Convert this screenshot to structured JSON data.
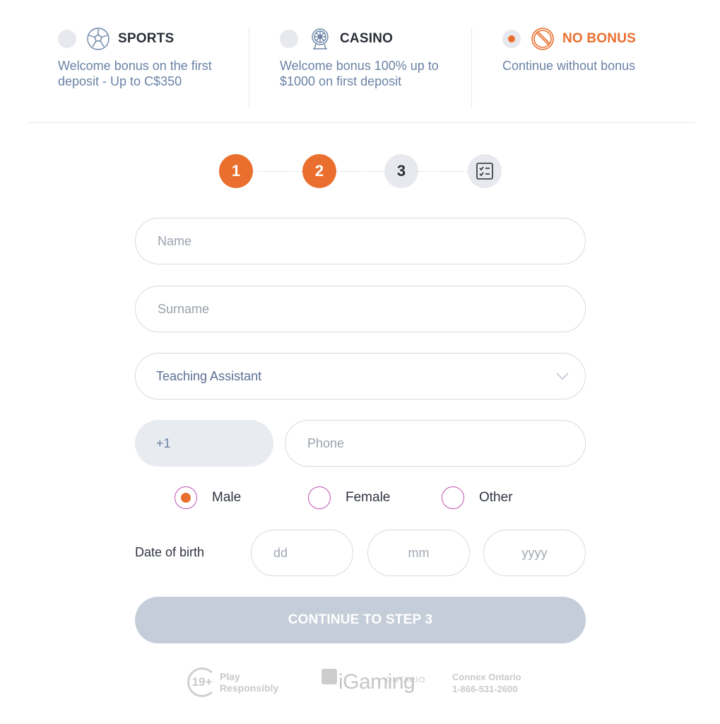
{
  "bonus_options": [
    {
      "id": "sports",
      "title": "SPORTS",
      "icon": "soccer-ball-icon",
      "description": "Welcome bonus on the first deposit - Up to C$350",
      "selected": false
    },
    {
      "id": "casino",
      "title": "CASINO",
      "icon": "fortune-wheel-icon",
      "description": "Welcome bonus 100% up to $1000 on first deposit",
      "selected": false
    },
    {
      "id": "no_bonus",
      "title": "NO BONUS",
      "icon": "prohibited-icon",
      "description": "Continue without bonus",
      "selected": true
    }
  ],
  "stepper": {
    "steps": [
      {
        "label": "1",
        "state": "done"
      },
      {
        "label": "2",
        "state": "done"
      },
      {
        "label": "3",
        "state": "todo"
      },
      {
        "label": "",
        "icon": "checklist-icon",
        "state": "todo"
      }
    ]
  },
  "form": {
    "name": {
      "placeholder": "Name",
      "value": ""
    },
    "surname": {
      "placeholder": "Surname",
      "value": ""
    },
    "occupation": {
      "selected": "Teaching Assistant"
    },
    "phone": {
      "prefix": "+1",
      "placeholder": "Phone",
      "value": ""
    },
    "gender": {
      "options": [
        "Male",
        "Female",
        "Other"
      ],
      "selected": "Male"
    },
    "dob": {
      "label": "Date of birth",
      "day_placeholder": "dd",
      "month_placeholder": "mm",
      "year_placeholder": "yyyy"
    },
    "continue_label": "CONTINUE TO STEP 3"
  },
  "footer": {
    "age_badge": "19+",
    "play_line1": "Play",
    "play_line2": "Responsibly",
    "igaming_sub": "ONTARIO",
    "igaming_main": "iGaming",
    "connex_line1": "Connex Ontario",
    "connex_line2": "1-866-531-2600"
  },
  "colors": {
    "accent": "#ea6f2e",
    "text_muted": "#6a83a6",
    "radio_border": "#c053b0",
    "button_disabled": "#c4cdd9"
  }
}
